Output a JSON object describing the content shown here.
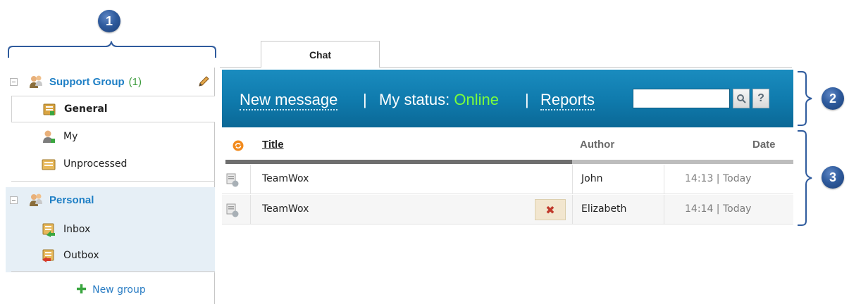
{
  "callouts": [
    "1",
    "2",
    "3"
  ],
  "tabs": {
    "chat": "Chat"
  },
  "sidebar": {
    "support_group": {
      "title": "Support Group",
      "count": "(1)"
    },
    "support_items": [
      {
        "label": "General",
        "icon": "general-folder-icon",
        "active": true
      },
      {
        "label": "My",
        "icon": "user-icon"
      },
      {
        "label": "Unprocessed",
        "icon": "folder-icon"
      }
    ],
    "personal_group": {
      "title": "Personal"
    },
    "personal_items": [
      {
        "label": "Inbox",
        "icon": "inbox-icon"
      },
      {
        "label": "Outbox",
        "icon": "outbox-icon"
      }
    ],
    "new_group": "New group"
  },
  "toolbar": {
    "new_message": "New message",
    "sep1": "|",
    "status_label": "My status:",
    "status_value": "Online",
    "sep2": "|",
    "reports": "Reports",
    "search_placeholder": "",
    "help": "?"
  },
  "table": {
    "headers": {
      "title": "Title",
      "author": "Author",
      "date": "Date"
    },
    "rows": [
      {
        "title": "TeamWox",
        "author": "John",
        "date": "14:13 | Today"
      },
      {
        "title": "TeamWox",
        "author": "Elizabeth",
        "date": "14:14 | Today",
        "deletable": true
      }
    ]
  },
  "colors": {
    "toolbar_bg": "#0f7aac",
    "online": "#7cff3b",
    "group_title": "#1e7fc5",
    "badge": "#2f5b9d"
  }
}
